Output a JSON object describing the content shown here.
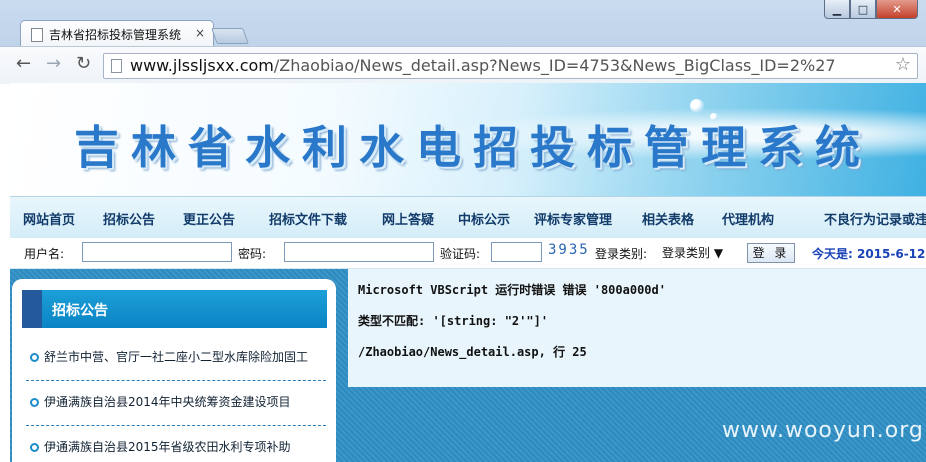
{
  "browser": {
    "tab_title": "吉林省招标投标管理系统",
    "tab_close": "×",
    "back": "←",
    "forward": "→",
    "reload": "↻",
    "url_host": "www.jlssljsxx.com",
    "url_path": "/Zhaobiao/News_detail.asp?News_ID=4753&News_BigClass_ID=2%27",
    "star": "☆",
    "win_min": "▁",
    "win_max": "□",
    "win_close": "✕"
  },
  "banner": {
    "title": "吉林省水利水电招投标管理系统"
  },
  "nav": {
    "items": [
      "网站首页",
      "招标公告",
      "更正公告",
      "招标文件下载",
      "网上答疑",
      "中标公示",
      "评标专家管理",
      "相关表格",
      "代理机构",
      "不良行为记录或违"
    ]
  },
  "login": {
    "username_label": "用户名:",
    "password_label": "密码:",
    "captcha_label": "验证码:",
    "captcha_value": "3935",
    "login_type_label": "登录类别:",
    "login_type_value": "登录类别",
    "login_button": "登 录",
    "today": "今天是: 2015-6-12"
  },
  "sidebar": {
    "heading": "招标公告",
    "items": [
      "舒兰市中营、官厅一社二座小二型水库除险加固工",
      "伊通满族自治县2014年中央统筹资金建设项目",
      "伊通满族自治县2015年省级农田水利专项补助"
    ]
  },
  "error": {
    "line1": "Microsoft VBScript 运行时错误 错误 '800a000d'",
    "line2": "类型不匹配: '[string: \"2'\"]'",
    "line3": "/Zhaobiao/News_detail.asp, 行 25"
  },
  "watermark": "www.wooyun.org"
}
